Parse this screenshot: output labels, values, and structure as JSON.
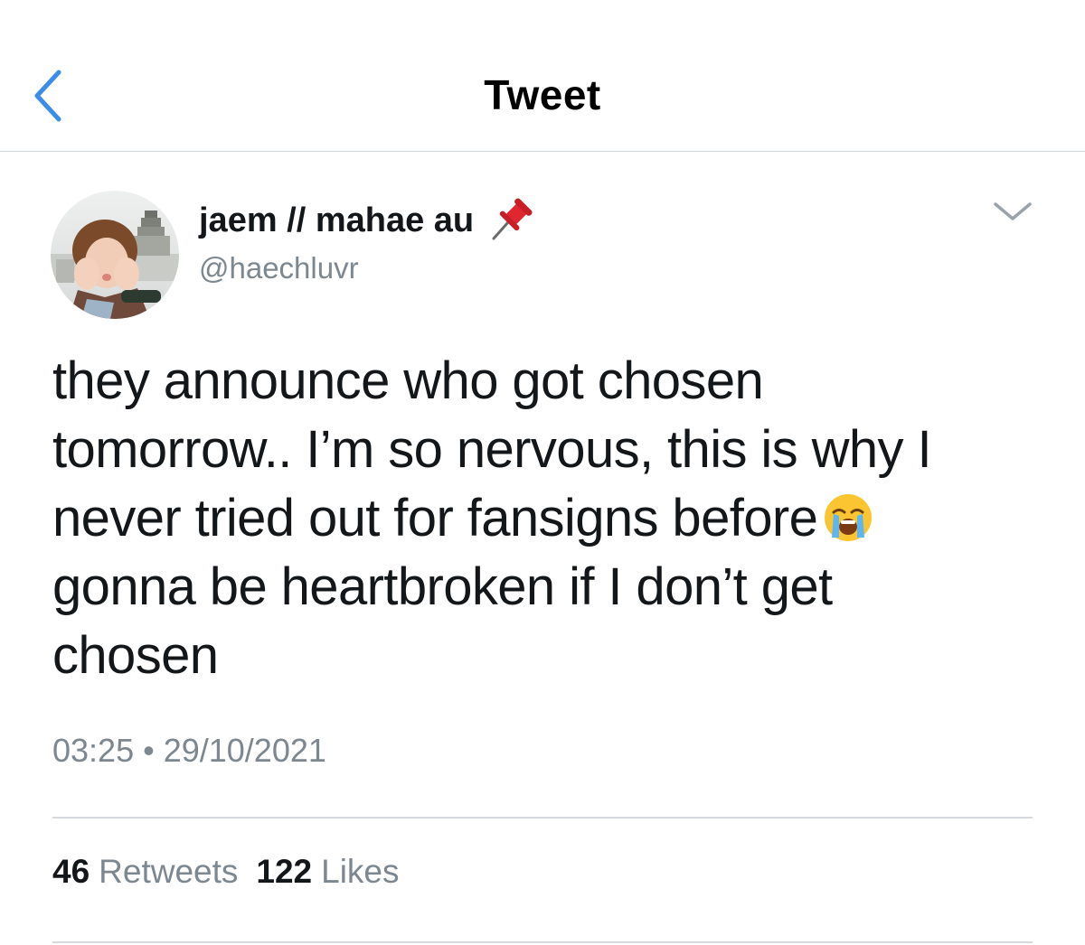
{
  "header": {
    "title": "Tweet",
    "back_icon": "chevron-left-icon",
    "accent_color": "#3b8ee8"
  },
  "author": {
    "display_name": "jaem // mahae au",
    "name_emoji": "pushpin-icon",
    "handle": "@haechluvr",
    "avatar": "avatar"
  },
  "tweet": {
    "lines": [
      "they announce who got chosen",
      "tomorrow.. I’m so nervous, this is why I",
      "never tried out for fansigns before",
      "gonna be heartbroken if I don’t get",
      "chosen"
    ],
    "emoji": "loudly-crying-face-icon"
  },
  "meta": {
    "time": "03:25",
    "separator": "•",
    "date": "29/10/2021"
  },
  "stats": {
    "retweets_count": "46",
    "retweets_label": "Retweets",
    "likes_count": "122",
    "likes_label": "Likes"
  }
}
